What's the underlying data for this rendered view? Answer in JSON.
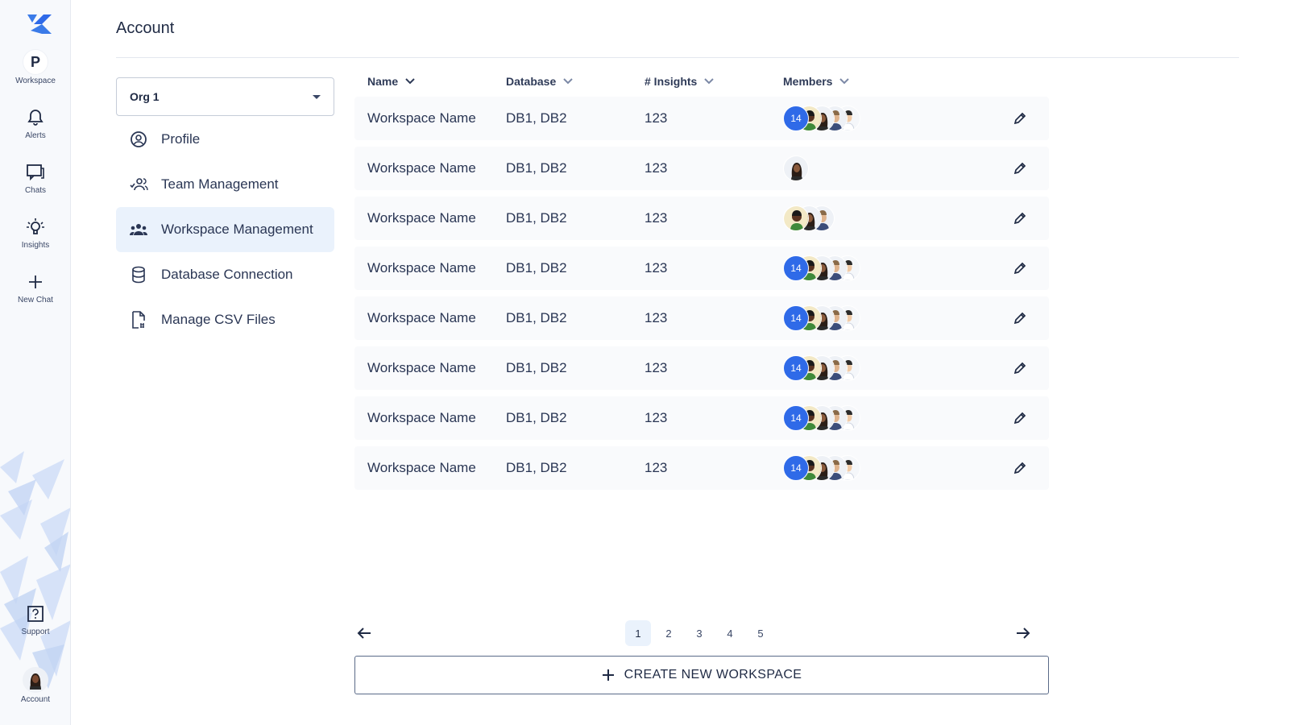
{
  "rail": {
    "workspace_initial": "P",
    "workspace_label": "Workspace",
    "alerts_label": "Alerts",
    "chats_label": "Chats",
    "insights_label": "Insights",
    "new_chat_label": "New Chat",
    "support_label": "Support",
    "account_label": "Account"
  },
  "header": {
    "title": "Account"
  },
  "org_select": {
    "value": "Org 1"
  },
  "nav": {
    "items": [
      {
        "label": "Profile",
        "icon": "user-circle-icon"
      },
      {
        "label": "Team Management",
        "icon": "team-icon"
      },
      {
        "label": "Workspace Management",
        "icon": "group-icon",
        "active": true
      },
      {
        "label": "Database Connection",
        "icon": "database-icon"
      },
      {
        "label": "Manage CSV Files",
        "icon": "csv-file-icon"
      }
    ]
  },
  "table": {
    "columns": [
      "Name",
      "Database",
      "# Insights",
      "Members"
    ],
    "rows": [
      {
        "name": "Workspace Name",
        "database": "DB1, DB2",
        "insights": "123",
        "member_count": "14",
        "avatars": 4
      },
      {
        "name": "Workspace Name",
        "database": "DB1, DB2",
        "insights": "123",
        "member_count": "",
        "avatars": 1
      },
      {
        "name": "Workspace Name",
        "database": "DB1, DB2",
        "insights": "123",
        "member_count": "",
        "avatars": 3
      },
      {
        "name": "Workspace Name",
        "database": "DB1, DB2",
        "insights": "123",
        "member_count": "14",
        "avatars": 4
      },
      {
        "name": "Workspace Name",
        "database": "DB1, DB2",
        "insights": "123",
        "member_count": "14",
        "avatars": 4
      },
      {
        "name": "Workspace Name",
        "database": "DB1, DB2",
        "insights": "123",
        "member_count": "14",
        "avatars": 4
      },
      {
        "name": "Workspace Name",
        "database": "DB1, DB2",
        "insights": "123",
        "member_count": "14",
        "avatars": 4
      },
      {
        "name": "Workspace Name",
        "database": "DB1, DB2",
        "insights": "123",
        "member_count": "14",
        "avatars": 4
      }
    ]
  },
  "pagination": {
    "pages": [
      "1",
      "2",
      "3",
      "4",
      "5"
    ],
    "current": "1"
  },
  "actions": {
    "create_label": "CREATE NEW WORKSPACE"
  },
  "colors": {
    "accent": "#2f6ae8",
    "active_bg": "#eaf2fc",
    "text": "#1f2a44"
  }
}
